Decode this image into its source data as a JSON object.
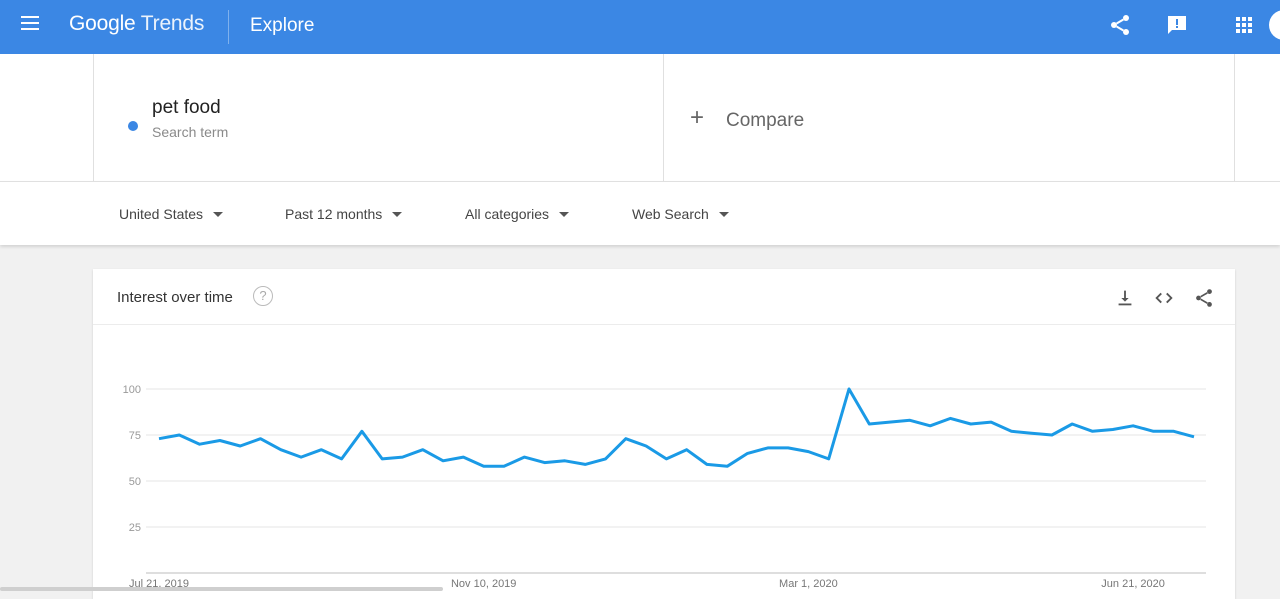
{
  "topbar": {
    "logo_google": "Google",
    "logo_trends": "Trends",
    "page": "Explore",
    "icons": [
      "menu-icon",
      "share-icon",
      "feedback-icon",
      "apps-icon"
    ]
  },
  "search_term": {
    "name": "pet food",
    "type": "Search term",
    "color": "#3b87e4"
  },
  "compare": {
    "plus": "+",
    "label": "Compare"
  },
  "filters": {
    "region": "United States",
    "time": "Past 12 months",
    "category": "All categories",
    "search_type": "Web Search"
  },
  "card": {
    "title": "Interest over time",
    "help": "?",
    "icons": [
      "download-icon",
      "embed-icon",
      "share-icon"
    ]
  },
  "chart_data": {
    "type": "line",
    "ylim": [
      0,
      100
    ],
    "yticks": [
      25,
      50,
      75,
      100
    ],
    "grid": true,
    "xtick_labels": [
      "Jul 21, 2019",
      "Nov 10, 2019",
      "Mar 1, 2020",
      "Jun 21, 2020"
    ],
    "xtick_index": [
      0,
      16,
      32,
      48
    ],
    "series": [
      {
        "color": "#1a9ae6",
        "values": [
          73,
          75,
          70,
          72,
          69,
          73,
          67,
          63,
          67,
          62,
          77,
          62,
          63,
          67,
          61,
          63,
          58,
          58,
          63,
          60,
          61,
          59,
          62,
          73,
          69,
          62,
          67,
          59,
          58,
          65,
          68,
          68,
          66,
          62,
          100,
          81,
          82,
          83,
          80,
          84,
          81,
          82,
          77,
          76,
          75,
          81,
          77,
          78,
          80,
          77,
          77,
          74
        ]
      }
    ]
  }
}
